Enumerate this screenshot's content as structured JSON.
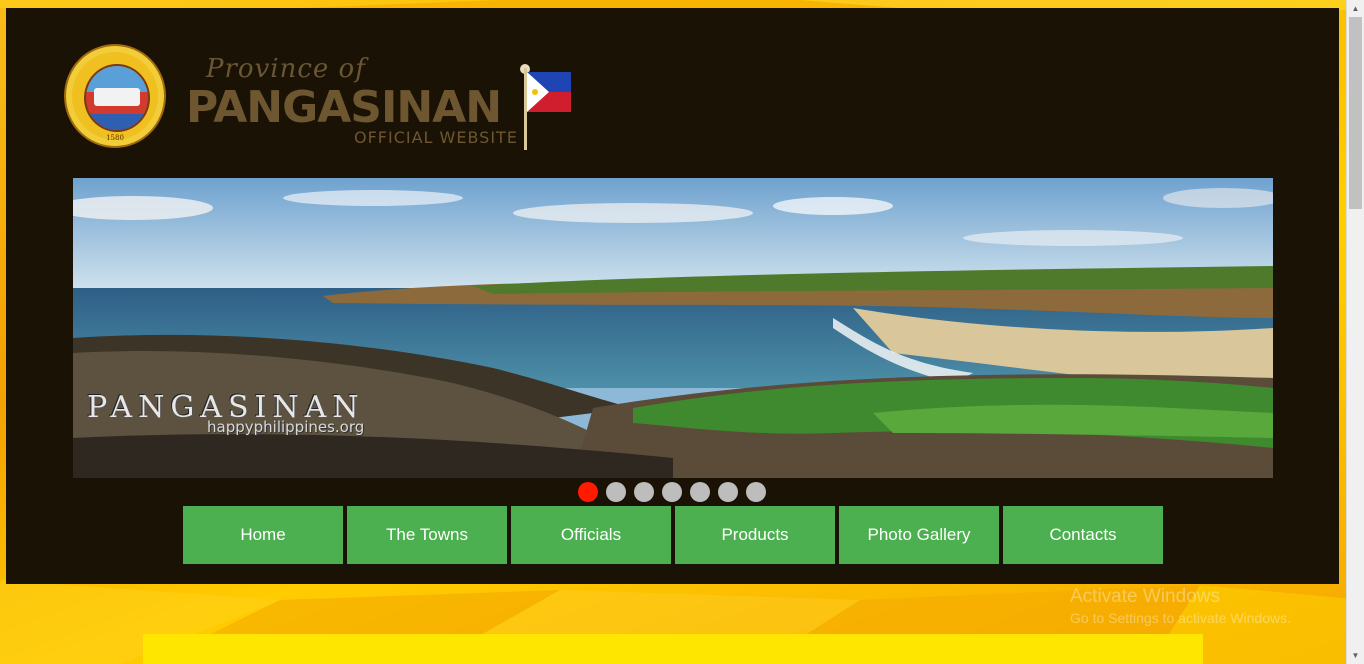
{
  "site": {
    "seal_year": "1580",
    "brand_script": "Province of",
    "brand_name": "PANGASINAN",
    "brand_sub": "OFFICIAL WEBSITE"
  },
  "hero": {
    "watermark_title": "PANGASINAN",
    "watermark_url": "happyphilippines.org"
  },
  "slider": {
    "slide_count": 7,
    "active_index": 0,
    "active_color": "#ff1a00",
    "inactive_color": "#bdbdbd"
  },
  "nav": {
    "items": [
      {
        "label": "Home"
      },
      {
        "label": "The Towns"
      },
      {
        "label": "Officials"
      },
      {
        "label": "Products"
      },
      {
        "label": "Photo Gallery"
      },
      {
        "label": "Contacts"
      }
    ],
    "color": "#4caf50"
  },
  "overlay": {
    "activate_title": "Activate Windows",
    "activate_sub": "Go to Settings to activate Windows."
  },
  "colors": {
    "header_bg": "#1a1305",
    "page_bg": "#f7b500",
    "strip": "#ffe600"
  }
}
